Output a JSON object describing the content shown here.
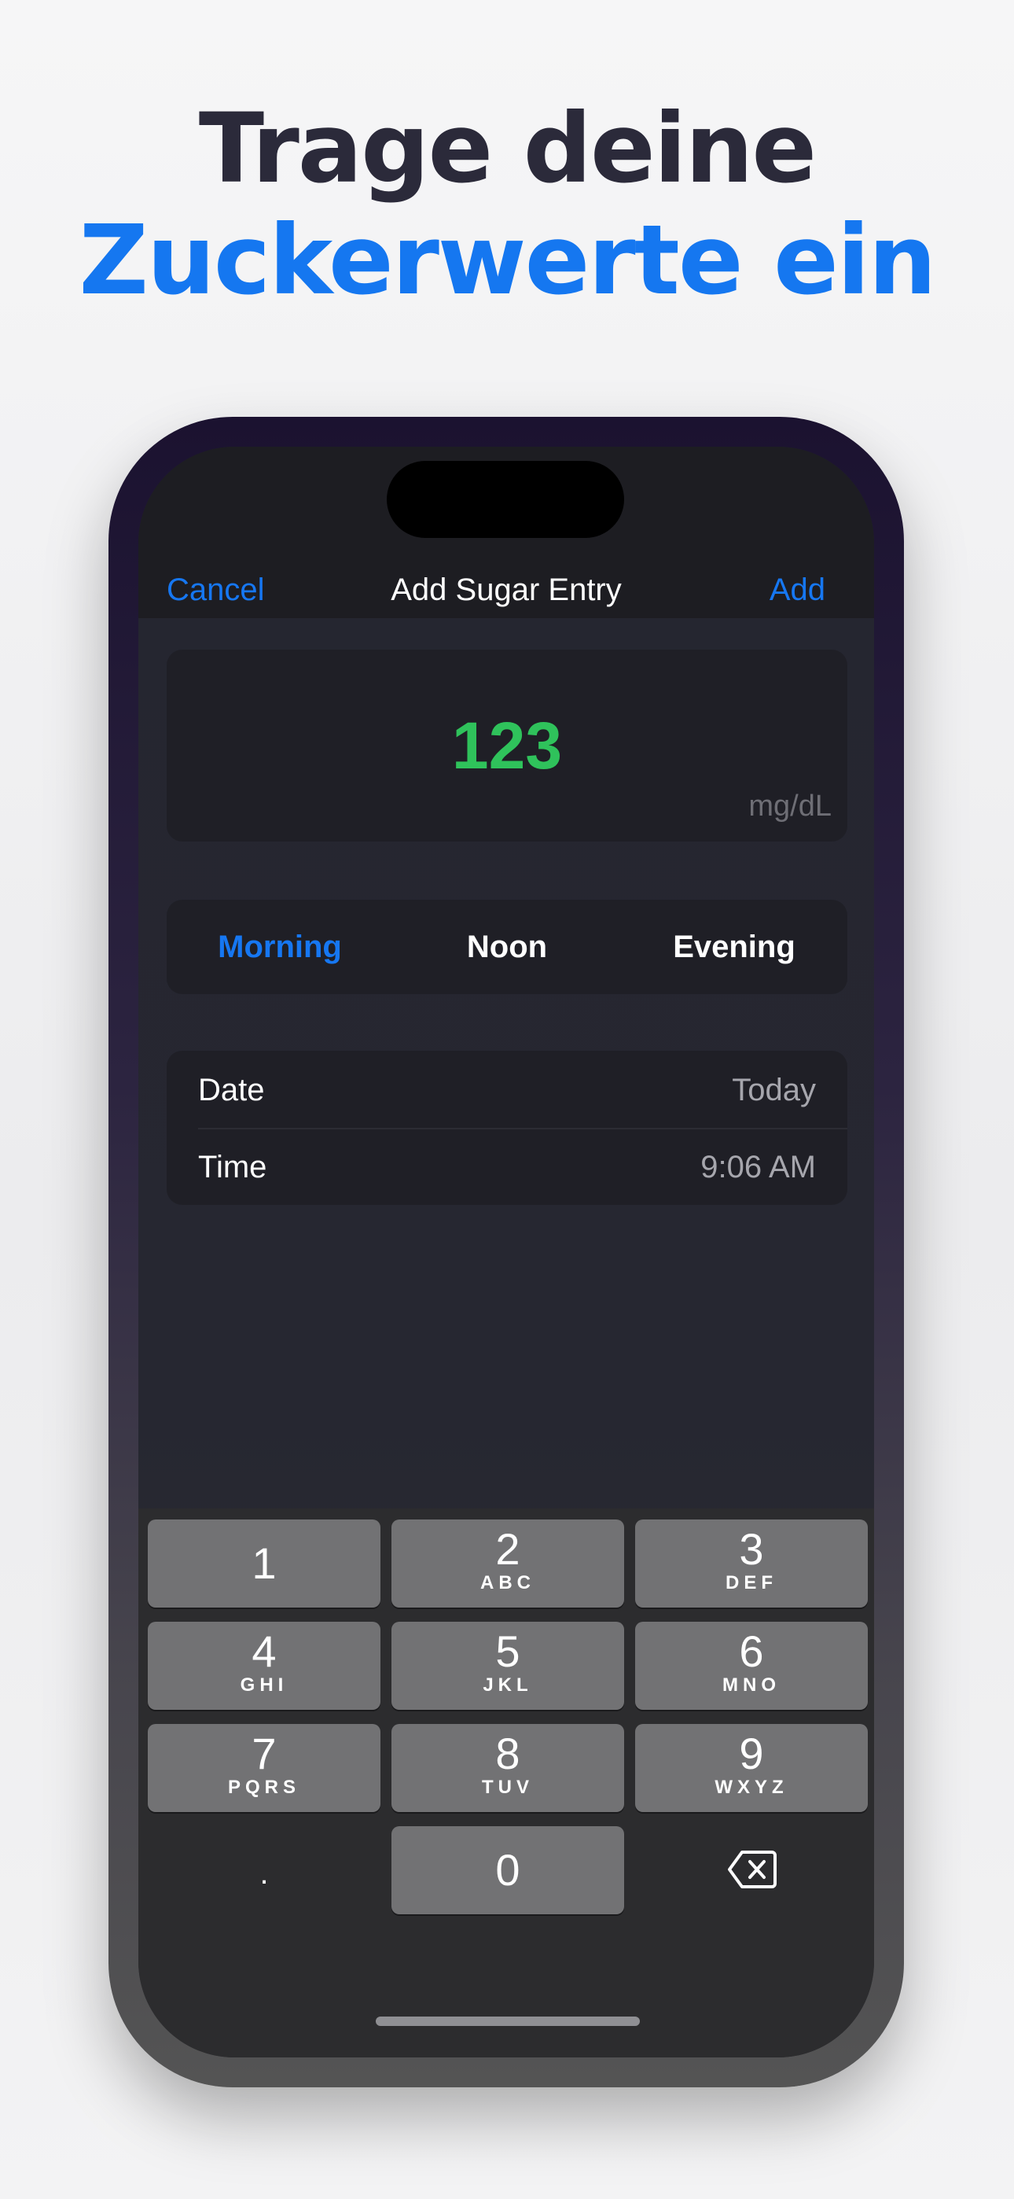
{
  "headline": {
    "line1": "Trage deine",
    "line2": "Zuckerwerte ein"
  },
  "nav": {
    "cancel": "Cancel",
    "title": "Add Sugar Entry",
    "add": "Add"
  },
  "entry": {
    "value": "123",
    "unit": "mg/dL",
    "value_color": "#2fc25b"
  },
  "segment": {
    "items": [
      "Morning",
      "Noon",
      "Evening"
    ],
    "selected": "Morning"
  },
  "details": {
    "date_label": "Date",
    "date_value": "Today",
    "time_label": "Time",
    "time_value": "9:06 AM"
  },
  "keypad": {
    "keys": [
      {
        "digit": "1",
        "letters": ""
      },
      {
        "digit": "2",
        "letters": "ABC"
      },
      {
        "digit": "3",
        "letters": "DEF"
      },
      {
        "digit": "4",
        "letters": "GHI"
      },
      {
        "digit": "5",
        "letters": "JKL"
      },
      {
        "digit": "6",
        "letters": "MNO"
      },
      {
        "digit": "7",
        "letters": "PQRS"
      },
      {
        "digit": "8",
        "letters": "TUV"
      },
      {
        "digit": "9",
        "letters": "WXYZ"
      },
      {
        "digit": ".",
        "letters": ""
      },
      {
        "digit": "0",
        "letters": ""
      },
      {
        "digit": "",
        "letters": "",
        "icon": "backspace-icon"
      }
    ]
  },
  "colors": {
    "accent": "#1677f2",
    "headline_dark": "#2b2a3a"
  }
}
